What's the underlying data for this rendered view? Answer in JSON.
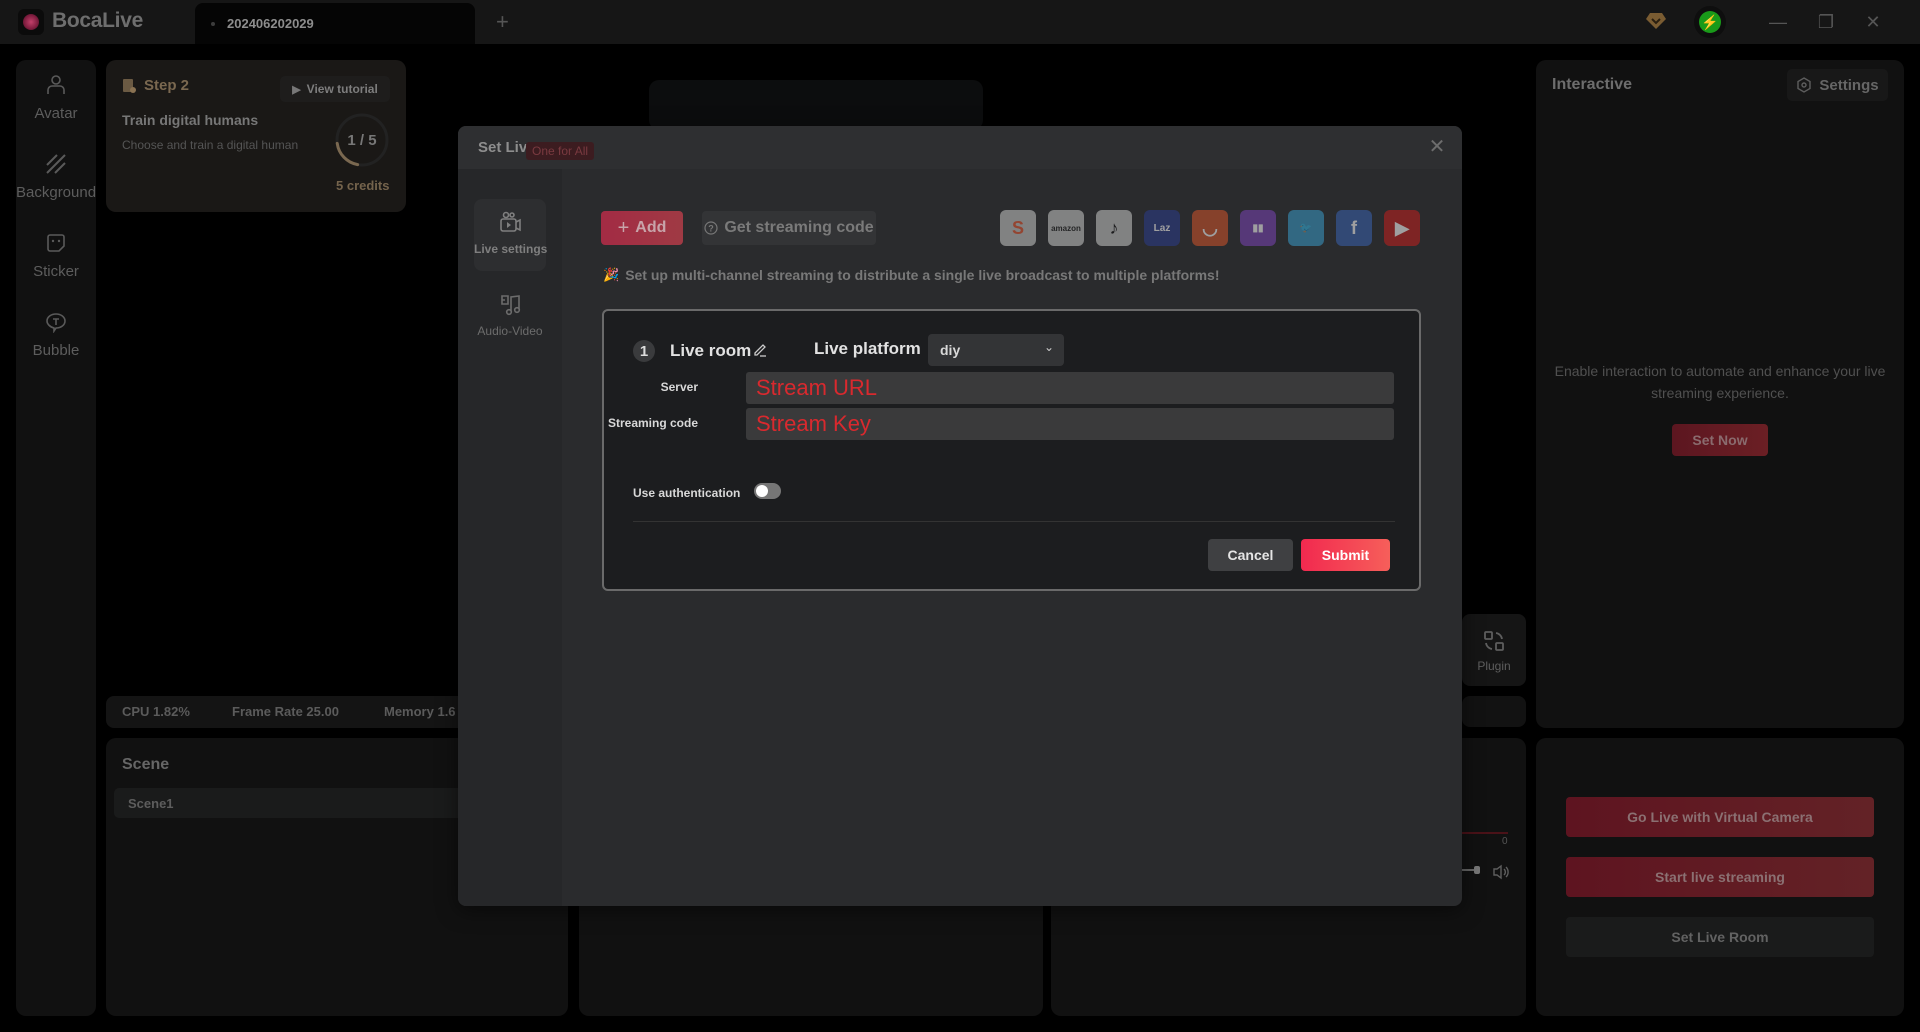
{
  "titlebar": {
    "app_name": "BocaLive",
    "tab_label": "202406202029",
    "new_tab": "+",
    "minimize": "—",
    "restore": "❐",
    "close": "✕"
  },
  "rail": {
    "items": [
      {
        "label": "Avatar",
        "icon": "avatar-icon"
      },
      {
        "label": "Background",
        "icon": "background-icon"
      },
      {
        "label": "Sticker",
        "icon": "sticker-icon"
      },
      {
        "label": "Bubble",
        "icon": "bubble-icon"
      }
    ]
  },
  "step_card": {
    "step_label": "Step 2",
    "view_tutorial": "View tutorial",
    "task_title": "Train digital humans",
    "task_desc": "Choose and train a digital human",
    "progress_text": "1 / 5",
    "progress_current": 1,
    "progress_total": 5,
    "credits": "5 credits"
  },
  "stats": {
    "cpu": "CPU 1.82%",
    "frame_rate": "Frame Rate 25.00",
    "memory": "Memory 1.6"
  },
  "scene": {
    "title": "Scene",
    "items": [
      "Scene1"
    ]
  },
  "plugin": {
    "label": "Plugin"
  },
  "audio": {
    "meter_zero": "0"
  },
  "interactive": {
    "title": "Interactive",
    "settings_label": "Settings",
    "description": "Enable interaction to automate and enhance your live streaming experience.",
    "set_now": "Set Now"
  },
  "live_actions": {
    "virtual_camera": "Go Live with Virtual Camera",
    "start_streaming": "Start live streaming",
    "set_live_room": "Set Live Room"
  },
  "dialog": {
    "title": "Set Live Room",
    "close": "✕",
    "nav": [
      {
        "label": "Live settings",
        "icon": "live-settings-icon",
        "active": true
      },
      {
        "label": "Audio-Video",
        "icon": "audio-video-icon",
        "active": false
      }
    ],
    "badge": "One for All",
    "add_label": "Add",
    "get_code_label": "Get streaming code",
    "platforms": [
      {
        "name": "Shopee",
        "color": "#e95b35",
        "bg": "#c9c9c9",
        "glyph": "S"
      },
      {
        "name": "Amazon",
        "color": "#222222",
        "bg": "#c9c9c9",
        "glyph": "amazon"
      },
      {
        "name": "TikTok",
        "color": "#111111",
        "bg": "#c9c9c9",
        "glyph": "♪"
      },
      {
        "name": "Lazada",
        "color": "#ffffff",
        "bg": "#2b3c8c",
        "glyph": "Laz"
      },
      {
        "name": "AliExpress",
        "color": "#ffffff",
        "bg": "#d2532a",
        "glyph": "◡"
      },
      {
        "name": "Twitch",
        "color": "#ffffff",
        "bg": "#7a43b6",
        "glyph": "▮▮"
      },
      {
        "name": "Twitter",
        "color": "#ffffff",
        "bg": "#3a9ac9",
        "glyph": "🐦"
      },
      {
        "name": "Facebook",
        "color": "#ffffff",
        "bg": "#3a62b0",
        "glyph": "f"
      },
      {
        "name": "YouTube",
        "color": "#ffffff",
        "bg": "#c4201e",
        "glyph": "▶"
      }
    ],
    "hint": "Set up multi-channel streaming to distribute a single live broadcast to multiple platforms!",
    "room": {
      "number": "1",
      "label": "Live room",
      "platform_label": "Live platform",
      "platform_value": "diy",
      "server_label": "Server",
      "server_placeholder": "Stream URL",
      "server_value": "",
      "code_label": "Streaming code",
      "code_placeholder": "Stream Key",
      "code_value": "",
      "auth_label": "Use authentication",
      "auth_enabled": false,
      "cancel": "Cancel",
      "submit": "Submit"
    }
  },
  "colors": {
    "accent": "#f2294f",
    "placeholder_red": "#d9292e",
    "dialog_bg": "#2a2b2d",
    "card_bg": "#1c1d1f"
  }
}
